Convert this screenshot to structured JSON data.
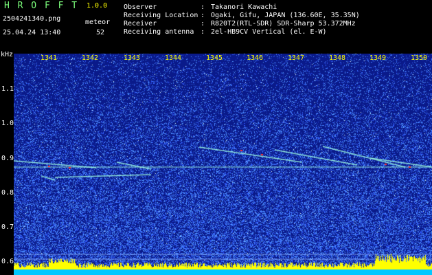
{
  "header": {
    "app_title": "H R O F F T",
    "app_version": "1.0.0",
    "filename": "2504241340.png",
    "datetime": "25.04.24 13:40",
    "meteor_label": "meteor",
    "meteor_count": "52",
    "info": [
      {
        "label": "Observer",
        "sep": ":",
        "value": "Takanori Kawachi"
      },
      {
        "label": "Receiving Location",
        "sep": ":",
        "value": "Ogaki, Gifu, JAPAN (136.60E, 35.35N)"
      },
      {
        "label": "Receiver",
        "sep": ":",
        "value": "R820T2(RTL-SDR) SDR-Sharp 53.372MHz"
      },
      {
        "label": "Receiving antenna",
        "sep": ":",
        "value": "2el-HB9CV Vertical (el. E-W)"
      }
    ]
  },
  "spectrogram": {
    "y_unit": "kHz",
    "y_ticks": [
      "1.1",
      "1.0",
      "0.9",
      "0.8",
      "0.7",
      "0.6"
    ],
    "x_ticks": [
      "1341",
      "1342",
      "1343",
      "1344",
      "1345",
      "1346",
      "1347",
      "1348",
      "1349",
      "1350"
    ],
    "colors": {
      "background": "#0a1a8a",
      "noise": "#5fa0ff",
      "trace": "#9fffe0",
      "hot": "#ff3030",
      "level_bar": "#ffff00",
      "baseline": "#00c8ff"
    }
  }
}
